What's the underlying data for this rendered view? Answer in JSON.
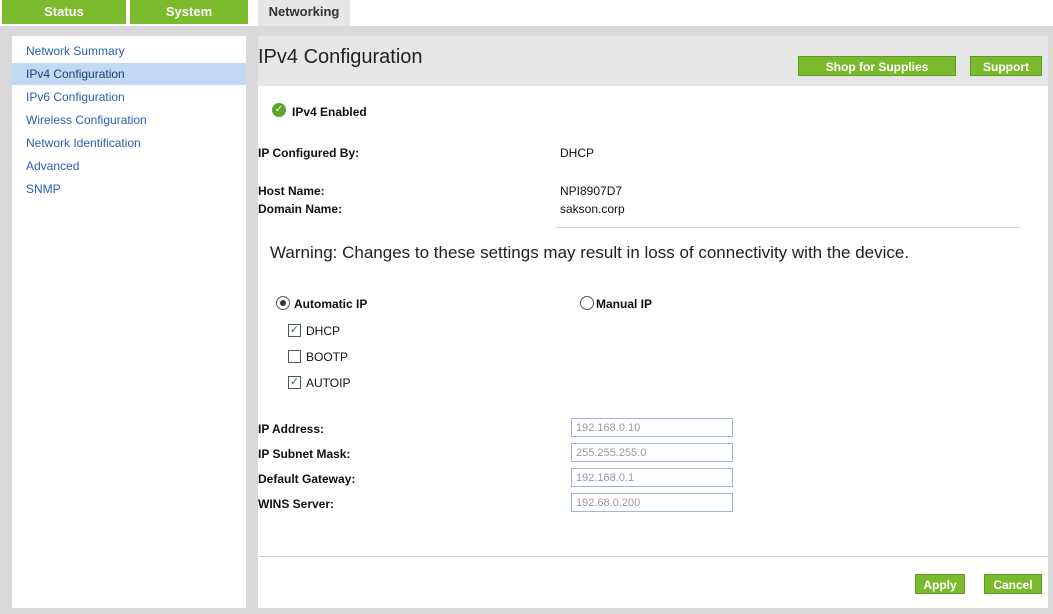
{
  "tabs": [
    {
      "label": "Status"
    },
    {
      "label": "System"
    },
    {
      "label": "Networking"
    }
  ],
  "sidebar": {
    "items": [
      {
        "label": "Network Summary"
      },
      {
        "label": "IPv4 Configuration"
      },
      {
        "label": "IPv6 Configuration"
      },
      {
        "label": "Wireless Configuration"
      },
      {
        "label": "Network Identification"
      },
      {
        "label": "Advanced"
      },
      {
        "label": "SNMP"
      }
    ]
  },
  "header": {
    "title": "IPv4 Configuration",
    "shop_label": "Shop for Supplies",
    "support_label": "Support"
  },
  "status": {
    "enabled_label": "IPv4 Enabled",
    "icon": "check-circle-icon"
  },
  "info": {
    "configured_by_label": "IP Configured By:",
    "configured_by_value": "DHCP",
    "host_name_label": "Host Name:",
    "host_name_value": "NPI8907D7",
    "domain_name_label": "Domain Name:",
    "domain_name_value": "sakson.corp"
  },
  "warning": "Warning: Changes to these settings may result in loss of connectivity with the device.",
  "mode": {
    "automatic_label": "Automatic IP",
    "manual_label": "Manual IP",
    "selected": "automatic"
  },
  "methods": [
    {
      "label": "DHCP",
      "checked": true
    },
    {
      "label": "BOOTP",
      "checked": false
    },
    {
      "label": "AUTOIP",
      "checked": true
    }
  ],
  "fields": {
    "ip_address_label": "IP Address:",
    "ip_address_value": "192.168.0.10",
    "subnet_label": "IP Subnet Mask:",
    "subnet_value": "255.255.255.0",
    "gateway_label": "Default Gateway:",
    "gateway_value": "192.168.0.1",
    "wins_label": "WINS Server:",
    "wins_value": "192.68.0.200"
  },
  "actions": {
    "apply_label": "Apply",
    "cancel_label": "Cancel"
  },
  "colors": {
    "accent_green": "#7bba2c",
    "link_blue": "#2a5fb0",
    "selected_bg": "#c3d9f3"
  }
}
